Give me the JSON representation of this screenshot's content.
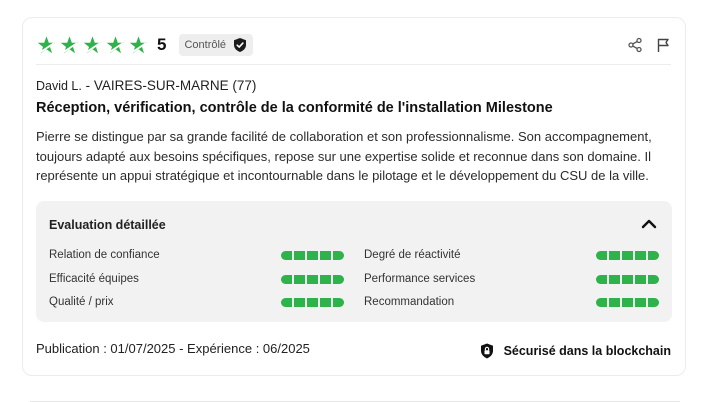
{
  "review": {
    "rating": 5,
    "rating_text": "5",
    "stars_filled": 5,
    "star_color": "#2eb24a",
    "badge_label": "Contrôlé",
    "author_name": "David L.",
    "author_sep": " - ",
    "author_location": "VAIRES-SUR-MARNE (77)",
    "title": "Réception, vérification, contrôle de la conformité de l'installation Milestone",
    "body": "Pierre se distingue par sa grande facilité de collaboration et son professionnalisme. Son accompagnement, toujours adapté aux besoins spécifiques, repose sur une expertise solide et reconnue dans son domaine. Il représente un appui stratégique et incontournable dans le pilotage et le développement du CSU de la ville.",
    "dates": "Publication : 01/07/2025  - Expérience : 06/2025",
    "secure_label": "Sécurisé dans la blockchain"
  },
  "icons": {
    "star": "star-icon",
    "badge": "shield-check-icon",
    "share": "share-icon",
    "report": "flag-icon",
    "toggle": "chevron-up-icon",
    "secure": "lock-shield-icon"
  },
  "evaluation": {
    "heading": "Evaluation détaillée",
    "meter_color": "#2eb24a",
    "left": [
      {
        "label": "Relation de confiance",
        "score": 5
      },
      {
        "label": "Efficacité équipes",
        "score": 5
      },
      {
        "label": "Qualité / prix",
        "score": 5
      }
    ],
    "right": [
      {
        "label": "Degré de réactivité",
        "score": 5
      },
      {
        "label": "Performance services",
        "score": 5
      },
      {
        "label": "Recommandation",
        "score": 5
      }
    ]
  }
}
